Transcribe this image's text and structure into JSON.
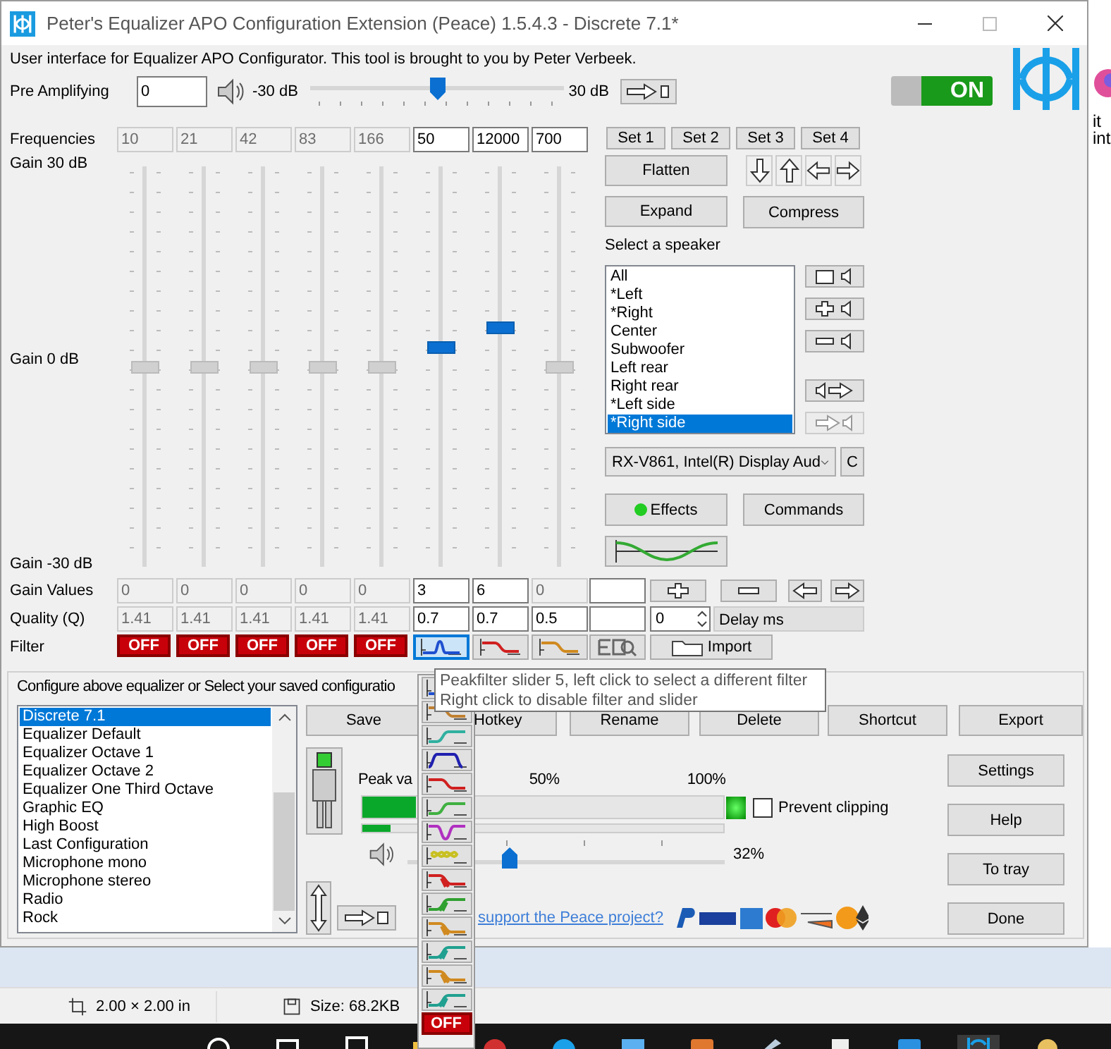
{
  "window": {
    "title": "Peter's Equalizer APO Configuration Extension (Peace) 1.5.4.3 - Discrete 7.1*"
  },
  "description": "User interface for Equalizer APO Configurator. This tool is brought to you by Peter Verbeek.",
  "pre_amp": {
    "label": "Pre Amplifying",
    "value": "0",
    "min_label": "-30 dB",
    "max_label": "30 dB",
    "level": 0.5
  },
  "power_switch": {
    "label": "ON",
    "on": true
  },
  "labels": {
    "frequencies": "Frequencies",
    "gain_top": "Gain 30 dB",
    "gain_mid": "Gain 0 dB",
    "gain_bottom": "Gain -30 dB",
    "gain_values": "Gain Values",
    "quality": "Quality (Q)",
    "filter": "Filter"
  },
  "bands": [
    {
      "frequency": "10",
      "gain": "0",
      "quality": "1.41",
      "enabled": false,
      "gain_enabled": false,
      "level": 0.5,
      "filter": {
        "kind": "off",
        "label": "OFF"
      }
    },
    {
      "frequency": "21",
      "gain": "0",
      "quality": "1.41",
      "enabled": false,
      "gain_enabled": false,
      "level": 0.5,
      "filter": {
        "kind": "off",
        "label": "OFF"
      }
    },
    {
      "frequency": "42",
      "gain": "0",
      "quality": "1.41",
      "enabled": false,
      "gain_enabled": false,
      "level": 0.5,
      "filter": {
        "kind": "off",
        "label": "OFF"
      }
    },
    {
      "frequency": "83",
      "gain": "0",
      "quality": "1.41",
      "enabled": false,
      "gain_enabled": false,
      "level": 0.5,
      "filter": {
        "kind": "off",
        "label": "OFF"
      }
    },
    {
      "frequency": "166",
      "gain": "0",
      "quality": "1.41",
      "enabled": false,
      "gain_enabled": false,
      "level": 0.5,
      "filter": {
        "kind": "off",
        "label": "OFF"
      }
    },
    {
      "frequency": "50",
      "gain": "3",
      "quality": "0.7",
      "enabled": true,
      "gain_enabled": true,
      "level": 0.55,
      "filter": {
        "kind": "peak",
        "color": "#1f50d0",
        "selected": true
      }
    },
    {
      "frequency": "12000",
      "gain": "6",
      "quality": "0.7",
      "enabled": true,
      "gain_enabled": true,
      "level": 0.6,
      "filter": {
        "kind": "lowpass",
        "color": "#d02020",
        "selected": false
      }
    },
    {
      "frequency": "700",
      "gain": "0",
      "quality": "0.5",
      "enabled": true,
      "gain_enabled": false,
      "level": 0.5,
      "filter": {
        "kind": "lowpass",
        "color": "#d08a20",
        "selected": false
      }
    }
  ],
  "sets": [
    "Set 1",
    "Set 2",
    "Set 3",
    "Set 4"
  ],
  "flatten": "Flatten",
  "expand": "Expand",
  "compress": "Compress",
  "speaker_label": "Select a speaker",
  "speakers": [
    {
      "name": "All",
      "selected": false
    },
    {
      "name": "*Left",
      "selected": false
    },
    {
      "name": "*Right",
      "selected": false
    },
    {
      "name": "Center",
      "selected": false
    },
    {
      "name": "Subwoofer",
      "selected": false
    },
    {
      "name": "Left rear",
      "selected": false
    },
    {
      "name": "Right rear",
      "selected": false
    },
    {
      "name": "*Left side",
      "selected": false
    },
    {
      "name": "*Right side",
      "selected": true
    }
  ],
  "device": "RX-V861, Intel(R) Display Aud",
  "device_button": "C",
  "effects": {
    "label": "Effects",
    "active": true
  },
  "commands": "Commands",
  "delay": {
    "value": "0",
    "label": "Delay ms"
  },
  "import_button": "Import",
  "presets": {
    "label": "Configure above equalizer or Select your saved configuratio",
    "items": [
      {
        "name": "Discrete 7.1",
        "selected": true
      },
      {
        "name": "Equalizer Default",
        "selected": false
      },
      {
        "name": "Equalizer Octave 1",
        "selected": false
      },
      {
        "name": "Equalizer Octave 2",
        "selected": false
      },
      {
        "name": "Equalizer One Third Octave",
        "selected": false
      },
      {
        "name": "Graphic EQ",
        "selected": false
      },
      {
        "name": "High Boost",
        "selected": false
      },
      {
        "name": "Last Configuration",
        "selected": false
      },
      {
        "name": "Microphone mono",
        "selected": false
      },
      {
        "name": "Microphone stereo",
        "selected": false
      },
      {
        "name": "Radio",
        "selected": false
      },
      {
        "name": "Rock",
        "selected": false
      }
    ]
  },
  "buttons": [
    "Save",
    "Hotkey",
    "Rename",
    "Delete",
    "Shortcut",
    "Export"
  ],
  "side_buttons": [
    "Settings",
    "Help",
    "To tray",
    "Done"
  ],
  "peak": {
    "label": "Peak va",
    "mid_label": "50%",
    "max_label": "100%"
  },
  "meters": [
    {
      "level": 0.15
    },
    {
      "level": 0.08
    }
  ],
  "prevent_clipping": {
    "label": "Prevent clipping",
    "checked": false
  },
  "volume": {
    "level": 0.32,
    "reading": "32%"
  },
  "support_link": "support the Peace project?",
  "tooltip": {
    "lines": [
      "Peakfilter slider 5, left click to select a different filter",
      "Right click to disable filter and slider"
    ]
  },
  "filter_menu": [
    {
      "kind": "peak",
      "color": "#1f50d0"
    },
    {
      "kind": "lowpass",
      "color": "#c08030"
    },
    {
      "kind": "highpass",
      "color": "#30b0a0"
    },
    {
      "kind": "bandpass",
      "color": "#2020b0"
    },
    {
      "kind": "lowpass",
      "color": "#d02020"
    },
    {
      "kind": "highpass",
      "color": "#40b040"
    },
    {
      "kind": "notch",
      "color": "#b030c0"
    },
    {
      "kind": "allpass",
      "color": "#c8c020"
    },
    {
      "kind": "lowshelf",
      "color": "#d02020"
    },
    {
      "kind": "highshelf",
      "color": "#30a030"
    },
    {
      "kind": "lowshelf",
      "color": "#d08a20"
    },
    {
      "kind": "highshelf",
      "color": "#20a090"
    },
    {
      "kind": "lowshelf",
      "color": "#d08a20"
    },
    {
      "kind": "highshelf",
      "color": "#20a090"
    },
    {
      "kind": "off",
      "label": "OFF"
    }
  ],
  "status_bar": {
    "dimensions": "2.00 × 2.00 in",
    "size": "Size: 68.2KB"
  },
  "background_text": [
    "it",
    "int"
  ]
}
